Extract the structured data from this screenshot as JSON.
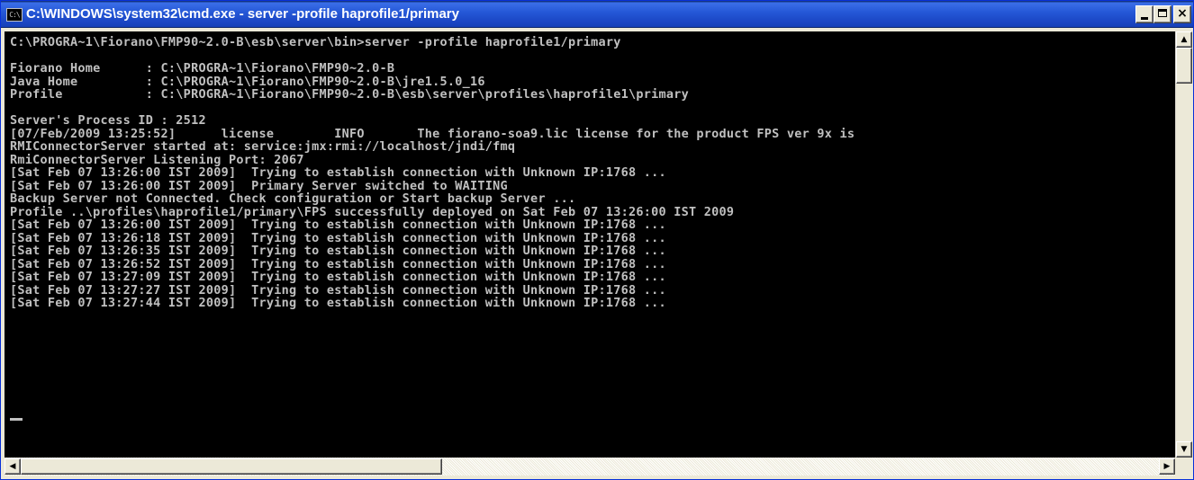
{
  "window": {
    "title": "C:\\WINDOWS\\system32\\cmd.exe - server -profile haprofile1/primary",
    "icon": "cmd-console-icon",
    "icon_text": "C:\\",
    "buttons": {
      "minimize": "minimize",
      "maximize": "maximize",
      "close": "×"
    }
  },
  "console": {
    "background": "#000000",
    "foreground": "#c0c0c0",
    "text": "C:\\PROGRA~1\\Fiorano\\FMP90~2.0-B\\esb\\server\\bin>server -profile haprofile1/primary\n\nFiorano Home      : C:\\PROGRA~1\\Fiorano\\FMP90~2.0-B\nJava Home         : C:\\PROGRA~1\\Fiorano\\FMP90~2.0-B\\jre1.5.0_16\nProfile           : C:\\PROGRA~1\\Fiorano\\FMP90~2.0-B\\esb\\server\\profiles\\haprofile1\\primary\n\nServer's Process ID : 2512\n[07/Feb/2009 13:25:52]      license        INFO       The fiorano-soa9.lic license for the product FPS ver 9x is\nRMIConnectorServer started at: service:jmx:rmi://localhost/jndi/fmq\nRmiConnectorServer Listening Port: 2067\n[Sat Feb 07 13:26:00 IST 2009]  Trying to establish connection with Unknown IP:1768 ...\n[Sat Feb 07 13:26:00 IST 2009]  Primary Server switched to WAITING\nBackup Server not Connected. Check configuration or Start backup Server ...\nProfile ..\\profiles\\haprofile1/primary\\FPS successfully deployed on Sat Feb 07 13:26:00 IST 2009\n[Sat Feb 07 13:26:00 IST 2009]  Trying to establish connection with Unknown IP:1768 ...\n[Sat Feb 07 13:26:18 IST 2009]  Trying to establish connection with Unknown IP:1768 ...\n[Sat Feb 07 13:26:35 IST 2009]  Trying to establish connection with Unknown IP:1768 ...\n[Sat Feb 07 13:26:52 IST 2009]  Trying to establish connection with Unknown IP:1768 ...\n[Sat Feb 07 13:27:09 IST 2009]  Trying to establish connection with Unknown IP:1768 ...\n[Sat Feb 07 13:27:27 IST 2009]  Trying to establish connection with Unknown IP:1768 ...\n[Sat Feb 07 13:27:44 IST 2009]  Trying to establish connection with Unknown IP:1768 ..."
  },
  "scrollbars": {
    "up_arrow": "▲",
    "down_arrow": "▼",
    "left_arrow": "◀",
    "right_arrow": "▶"
  },
  "colors": {
    "titlebar": "#2457d6",
    "chrome": "#ece9d8"
  }
}
